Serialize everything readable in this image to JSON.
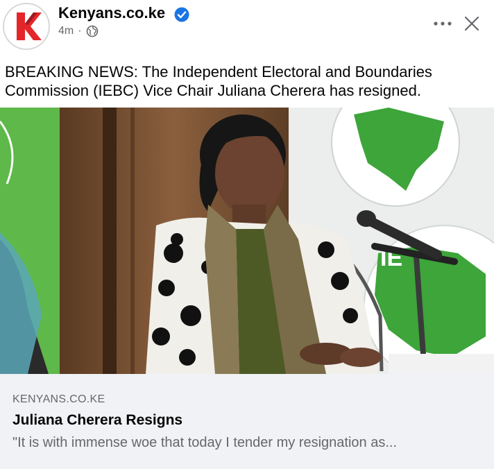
{
  "post": {
    "page_name": "Kenyans.co.ke",
    "time_ago": "4m",
    "separator": "·",
    "audience_icon": "globe-icon",
    "verified_icon": "verified-badge-icon",
    "text": "BREAKING NEWS: The Independent Electoral and Boundaries Commission (IEBC) Vice Chair Juliana Cherera has resigned."
  },
  "header_actions": {
    "more_icon": "more-horizontal-icon",
    "close_icon": "close-icon"
  },
  "link_preview": {
    "domain": "KENYANS.CO.KE",
    "title": "Juliana Cherera Resigns",
    "description": "\"It is with immense woe that today I tender my resignation as..."
  },
  "photo": {
    "backdrop_text": "IE"
  },
  "colors": {
    "brand_red": "#e4262b",
    "verified_blue": "#1b74e4",
    "card_bg": "#f0f2f5",
    "muted_text": "#65676b",
    "iebc_green": "#3da53a"
  }
}
